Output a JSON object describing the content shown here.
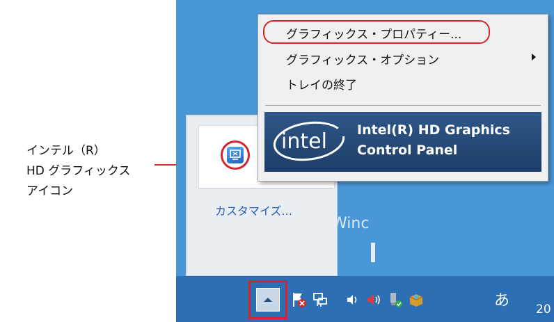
{
  "callout": {
    "line1": "インテル（R）",
    "line2": "HD グラフィックス",
    "line3": "アイコン"
  },
  "context_menu": {
    "items": [
      {
        "label": "グラフィックス・プロパティー..."
      },
      {
        "label": "グラフィックス・オプション",
        "has_submenu": true
      },
      {
        "label": "トレイの終了"
      }
    ],
    "banner": {
      "line1": "Intel(R) HD Graphics",
      "line2": "Control Panel"
    }
  },
  "overflow": {
    "customize_label": "カスタマイズ..."
  },
  "desktop": {
    "watermark": "Winc"
  },
  "taskbar": {
    "ime_label": "あ",
    "clock_partial": "20",
    "tray_icons": [
      "action-center-flag-icon",
      "network-icon",
      "volume-icon",
      "speaker-icon",
      "safely-remove-usb-icon",
      "dropbox-box-icon"
    ]
  },
  "colors": {
    "highlight_red": "#d4252d",
    "desktop_blue": "#4a97d8",
    "taskbar_blue": "#2d6fb5",
    "intel_banner": "#1d3d68"
  }
}
